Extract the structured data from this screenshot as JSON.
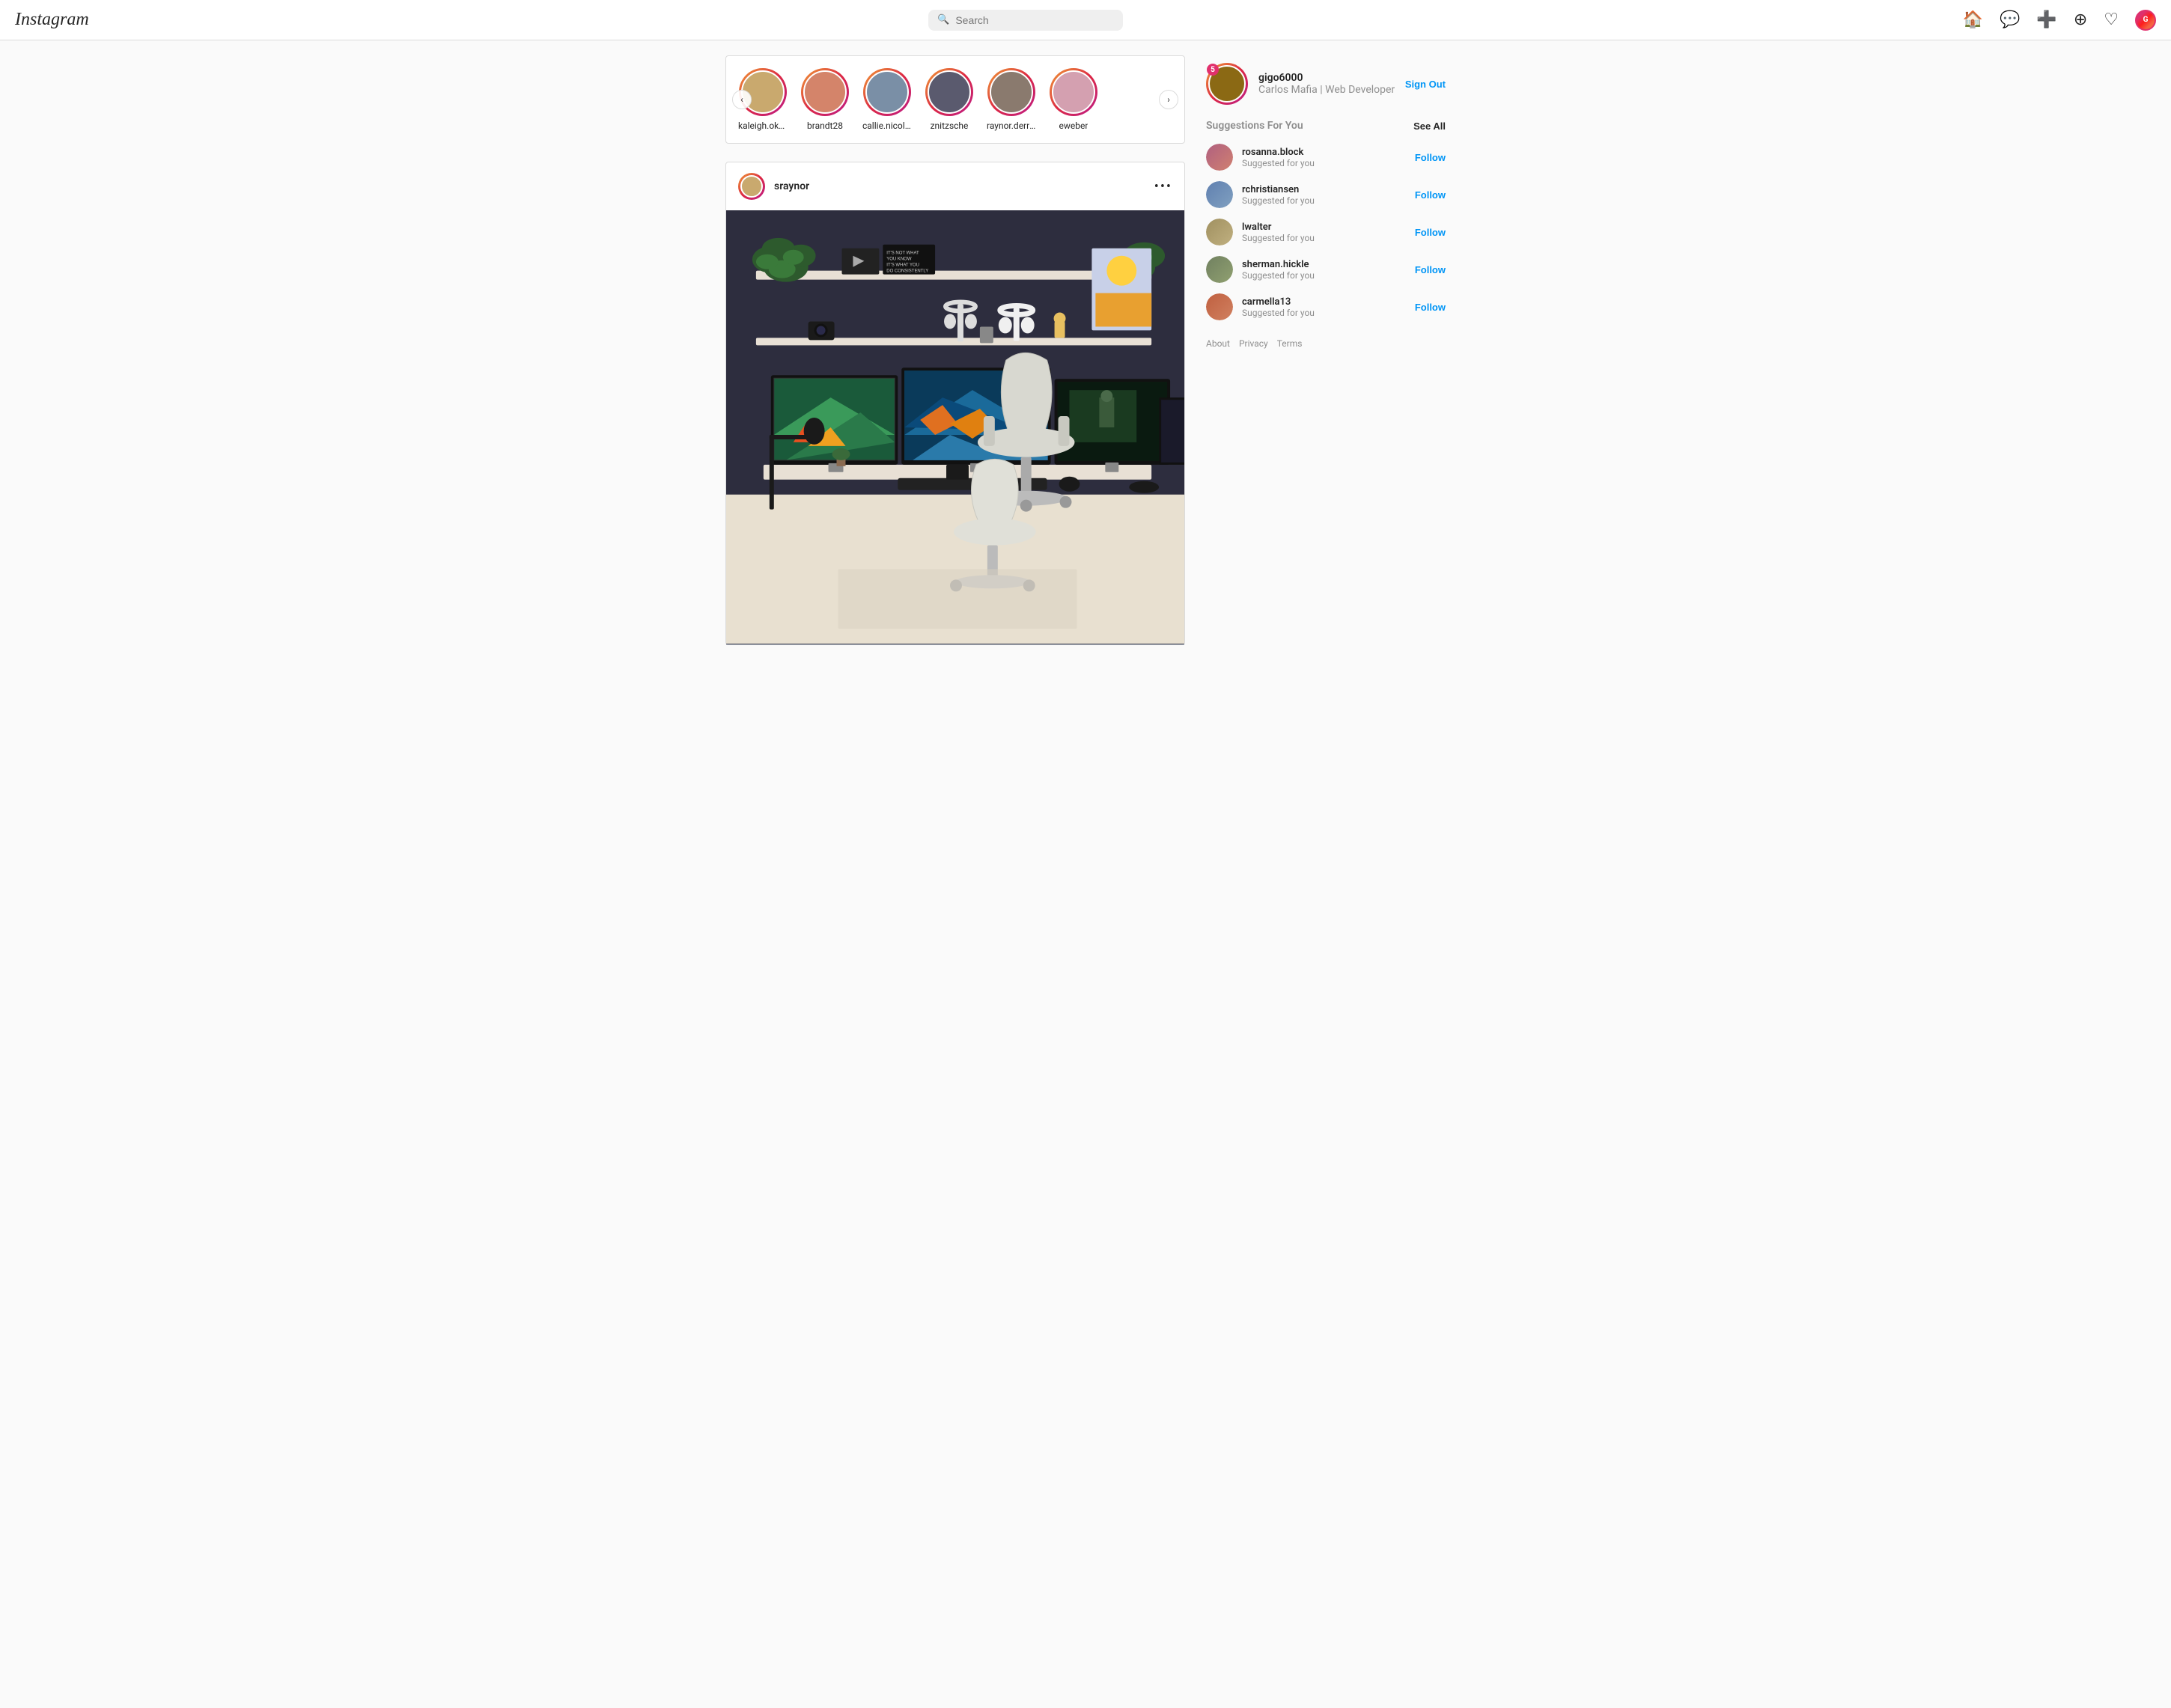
{
  "header": {
    "logo": "Instagram",
    "search_placeholder": "Search",
    "nav_icons": [
      "home",
      "messenger",
      "add",
      "explore",
      "heart",
      "profile"
    ]
  },
  "stories": {
    "prev_label": "‹",
    "next_label": "›",
    "items": [
      {
        "username": "kaleigh.oke...",
        "color": "av1"
      },
      {
        "username": "brandt28",
        "color": "av2"
      },
      {
        "username": "callie.nicolas",
        "color": "av3"
      },
      {
        "username": "znitzsche",
        "color": "av4"
      },
      {
        "username": "raynor.derrick",
        "color": "av5"
      },
      {
        "username": "eweber",
        "color": "av6"
      }
    ]
  },
  "post": {
    "username": "sraynor",
    "more_icon": "•••"
  },
  "sidebar": {
    "username": "gigo6000",
    "fullname": "Carlos Mafia | Web Developer",
    "badge": "5",
    "sign_out": "Sign Out",
    "suggestions_title": "Suggestions For You",
    "see_all": "See All",
    "suggestions": [
      {
        "username": "rosanna.block",
        "sub": "Suggested for you",
        "color": "sg1"
      },
      {
        "username": "rchristiansen",
        "sub": "Suggested for you",
        "color": "sg2"
      },
      {
        "username": "lwalter",
        "sub": "Suggested for you",
        "color": "sg3"
      },
      {
        "username": "sherman.hickle",
        "sub": "Suggested for you",
        "color": "sg4"
      },
      {
        "username": "carmella13",
        "sub": "Suggested for you",
        "color": "sg5"
      }
    ],
    "follow_label": "Follow",
    "footer_links": [
      "About",
      "Privacy",
      "Terms"
    ]
  }
}
